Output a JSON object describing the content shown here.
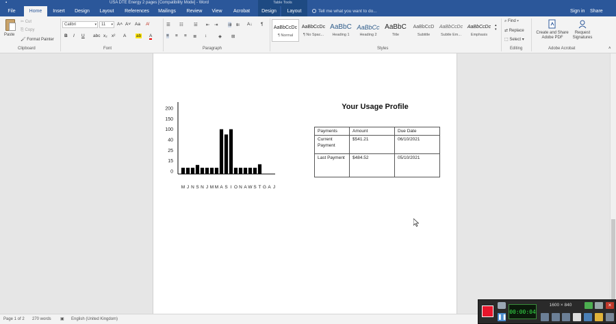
{
  "window": {
    "title": "USA DTE Energy 2 pages [Compatibility Mode] - Word",
    "context_group": "Table Tools"
  },
  "tabs": [
    {
      "label": "File"
    },
    {
      "label": "Home"
    },
    {
      "label": "Insert"
    },
    {
      "label": "Design"
    },
    {
      "label": "Layout"
    },
    {
      "label": "References"
    },
    {
      "label": "Mailings"
    },
    {
      "label": "Review"
    },
    {
      "label": "View"
    },
    {
      "label": "Acrobat"
    },
    {
      "label": "Design"
    },
    {
      "label": "Layout"
    }
  ],
  "tell_me": "Tell me what you want to do...",
  "account": {
    "sign_in": "Sign in",
    "share": "Share"
  },
  "ribbon": {
    "clipboard": {
      "paste": "Paste",
      "cut": "Cut",
      "copy": "Copy",
      "format_painter": "Format Painter",
      "label": "Clipboard"
    },
    "font": {
      "name": "Calibri",
      "size": "11",
      "label": "Font",
      "bold": "B",
      "italic": "I",
      "underline": "U"
    },
    "paragraph": {
      "label": "Paragraph"
    },
    "styles": {
      "label": "Styles",
      "items": [
        {
          "preview": "AaBbCcDc",
          "name": "¶ Normal"
        },
        {
          "preview": "AaBbCcDc",
          "name": "¶ No Spac..."
        },
        {
          "preview": "AaBbC",
          "name": "Heading 1"
        },
        {
          "preview": "AaBbCc",
          "name": "Heading 2"
        },
        {
          "preview": "AaBbC",
          "name": "Title"
        },
        {
          "preview": "AaBbCcD",
          "name": "Subtitle"
        },
        {
          "preview": "AaBbCcDc",
          "name": "Subtle Em..."
        },
        {
          "preview": "AaBbCcDc",
          "name": "Emphasis"
        }
      ]
    },
    "editing": {
      "find": "Find",
      "replace": "Replace",
      "select": "Select",
      "label": "Editing"
    },
    "acrobat": {
      "create_share": "Create and Share Adobe PDF",
      "request_signatures": "Request Signatures",
      "label": "Adobe Acrobat"
    }
  },
  "document": {
    "title": "Your Usage Profile",
    "table": {
      "headers": [
        "Payments",
        "Amount",
        "Due Date"
      ],
      "rows": [
        [
          "Current Payment",
          "$541.21",
          "06/10/2021"
        ],
        [
          "Last Payment",
          "$484.52",
          "05/10/2021"
        ]
      ]
    }
  },
  "chart_data": {
    "type": "bar",
    "categories": [
      "M",
      "J",
      "N",
      "S",
      "N",
      "J",
      "M",
      "M",
      "A",
      "S",
      "I",
      "O",
      "N",
      "A",
      "W",
      "S",
      "T",
      "G",
      "A",
      "J"
    ],
    "values": [
      5,
      5,
      5,
      9,
      5,
      5,
      5,
      5,
      100,
      70,
      100,
      5,
      5,
      5,
      5,
      5,
      10,
      "",
      "",
      ""
    ],
    "yticks": [
      "0",
      "15",
      "25",
      "40",
      "100",
      "150",
      "200"
    ]
  },
  "status_bar": {
    "page": "Page 1 of 2",
    "words": "270 words",
    "language": "English (United Kingdom)"
  },
  "recorder": {
    "time": "00:00:04",
    "resolution": "1600 × 840"
  }
}
